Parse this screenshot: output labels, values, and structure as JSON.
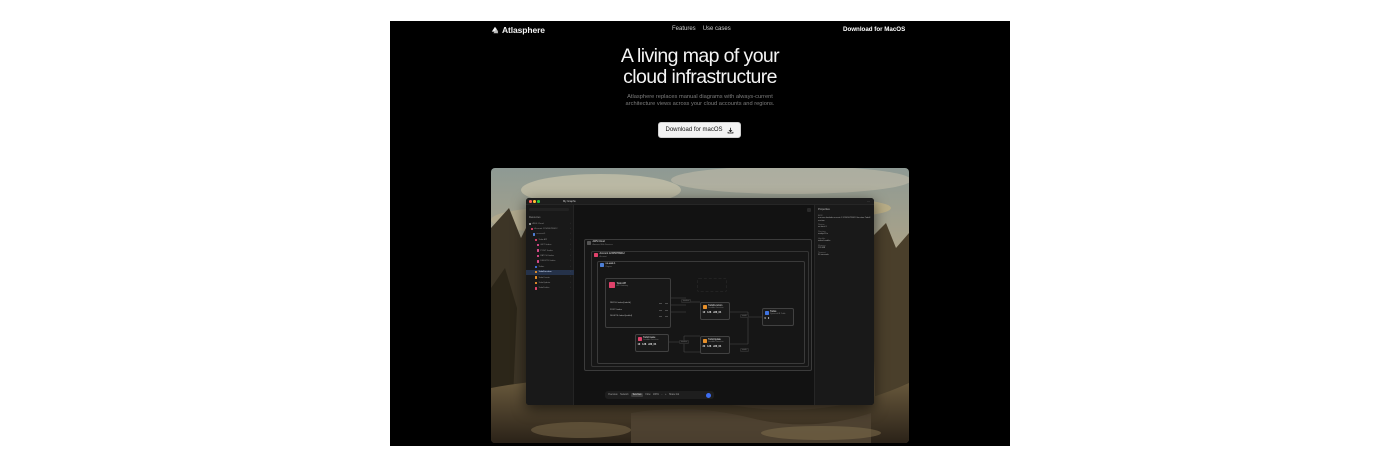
{
  "nav": {
    "brand": "Atlasphere",
    "links": [
      "Features",
      "Use cases"
    ],
    "download": "Download for MacOS",
    "logo_icon": "atlasphere-logo"
  },
  "hero": {
    "title_line1": "A living map of your",
    "title_line2": "cloud infrastructure",
    "subtitle_line1": "Atlasphere replaces manual diagrams with always-current",
    "subtitle_line2": "architecture views across your cloud accounts and regions.",
    "cta": "Download for macOS",
    "cta_icon": "download-icon"
  },
  "app": {
    "tab": "My Graphs",
    "sidebar": {
      "heading": "Resources",
      "items": [
        {
          "label": "AWS Cloud",
          "color": "#9a9a9a"
        },
        {
          "label": "Account 123456789012",
          "color": "#e0426b"
        },
        {
          "label": "us-east-1",
          "color": "#4d7fd6"
        },
        {
          "label": "Todo API",
          "color": "#e0426b"
        },
        {
          "label": "GET /todos",
          "color": "#d84a8a"
        },
        {
          "label": "POST /todos",
          "color": "#d84a8a"
        },
        {
          "label": "PATCH /todos",
          "color": "#d84a8a"
        },
        {
          "label": "DELETE /todos",
          "color": "#d84a8a"
        },
        {
          "label": "Todos",
          "color": "#3f73e0"
        },
        {
          "label": "TodoFunction",
          "color": "#e7902a"
        },
        {
          "label": "TodoCreate",
          "color": "#e7902a"
        },
        {
          "label": "TodoUpdate",
          "color": "#e7902a"
        },
        {
          "label": "TodoDelete",
          "color": "#e0426b"
        }
      ]
    },
    "properties": {
      "heading": "Properties",
      "rows": [
        {
          "key": "ARN",
          "value": "arn:aws:lambda:us-east-1:123456789012:function:TodoFunction"
        },
        {
          "key": "Region",
          "value": "us-east-1"
        },
        {
          "key": "Runtime",
          "value": "nodejs20.x"
        },
        {
          "key": "Handler",
          "value": "index.handler"
        },
        {
          "key": "Memory",
          "value": "128 MB"
        },
        {
          "key": "Timeout",
          "value": "30 seconds"
        }
      ]
    },
    "diagram": {
      "cloud": {
        "title": "AWS Cloud",
        "sub": "Amazon Web Services"
      },
      "account": {
        "title": "Account 123456789012",
        "sub": "Account"
      },
      "region": {
        "title": "us-east-1",
        "sub": "Region"
      },
      "api": {
        "title": "Todo API",
        "sub": "API Gateway",
        "routes": [
          "PATCH /todos/{todoId}",
          "POST /todos",
          "DELETE /todos/{todoId}"
        ]
      },
      "func_main": {
        "title": "TodoFunction",
        "sub": "Lambda Function",
        "stats": [
          "10",
          "128",
          "x86_64"
        ]
      },
      "func_a": {
        "title": "TodoCreate",
        "sub": "Lambda Function",
        "stats": [
          "10",
          "128",
          "x86_64"
        ]
      },
      "func_b": {
        "title": "TodoUpdate",
        "sub": "Lambda Function",
        "stats": [
          "30",
          "128",
          "x86_64"
        ]
      },
      "table": {
        "title": "Todos",
        "sub": "DynamoDB Table",
        "stats": [
          "0",
          "0"
        ]
      },
      "labels": {
        "invoke": "invokes",
        "reads": "reads"
      }
    },
    "bottombar": {
      "items": [
        "Overview",
        "Network",
        "Services",
        "Flow"
      ],
      "active_index": 2,
      "zoom": "100%",
      "share": "Share link"
    }
  }
}
